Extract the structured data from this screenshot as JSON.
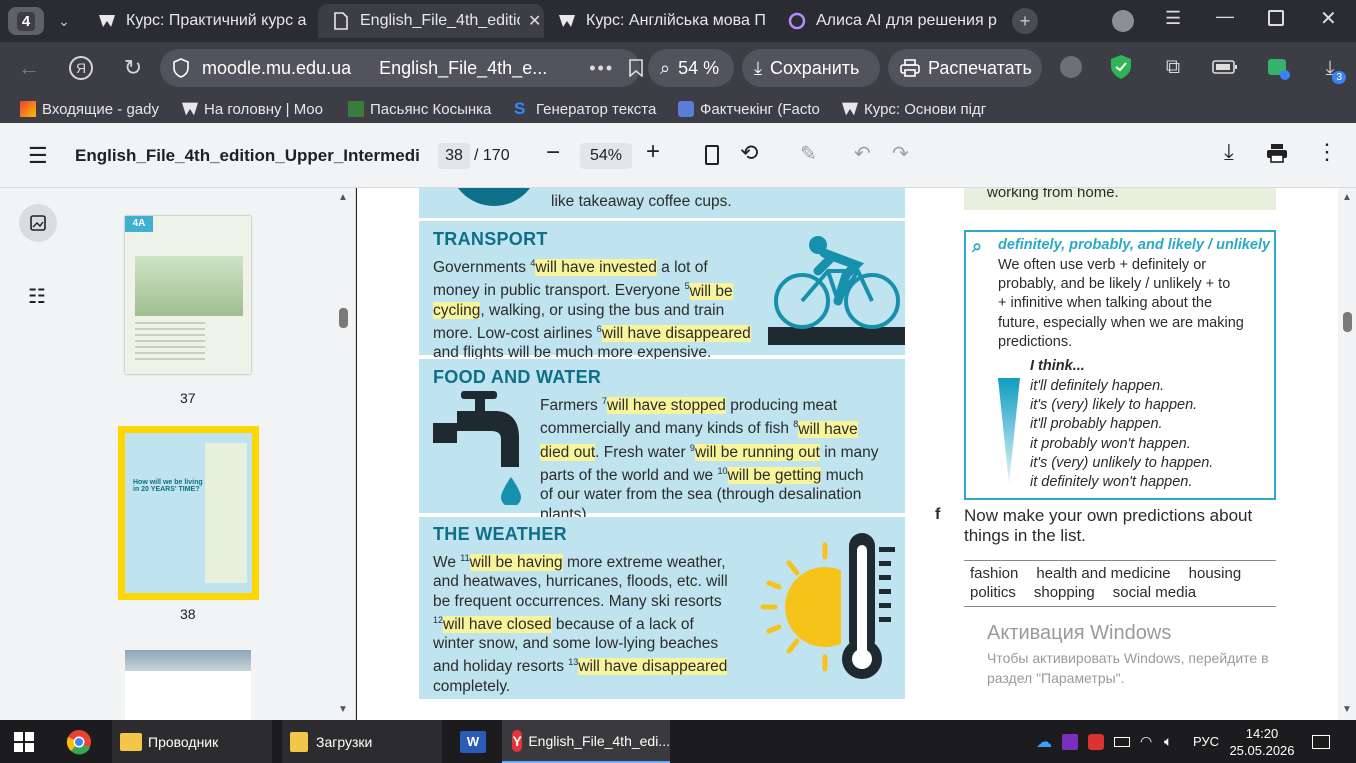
{
  "browser": {
    "tab_count": "4",
    "tabs": [
      {
        "label": "Курс: Практичний курс а"
      },
      {
        "label": "English_File_4th_editio"
      },
      {
        "label": "Курс: Англійська мова П"
      },
      {
        "label": "Алиса AI для решения р"
      }
    ],
    "address": {
      "domain": "moodle.mu.edu.ua",
      "page_title": "English_File_4th_e..."
    },
    "zoom_button": "54 %",
    "save_button": "Сохранить",
    "print_button": "Распечатать",
    "download_badge": "3",
    "bookmarks": [
      "Входящие - gady",
      "На головну | Moo",
      "Пасьянс Косынка",
      "Генератор текста",
      "Фактчекінг (Facto",
      "Курс: Основи підг"
    ],
    "colors": {
      "tabbar": "#2b2c33",
      "toolbar": "#3c3d45",
      "accent": "#2aa9c6",
      "highlight": "#f7f49a"
    }
  },
  "pdf": {
    "title": "English_File_4th_edition_Upper_Intermediat...",
    "page_current": "38",
    "page_total": "/ 170",
    "zoom": "54%",
    "thumbnails": [
      {
        "page": "37",
        "header": "4A"
      },
      {
        "page": "38",
        "header": "How will we be living in 20 YEARS' TIME?"
      }
    ]
  },
  "document": {
    "top_line": "like takeaway coffee cups.",
    "transport": {
      "title": "TRANSPORT",
      "l1a": "Governments ",
      "s4": "4",
      "h4": "will have invested",
      "l1b": " a lot of",
      "l2a": "money in public transport. Everyone ",
      "s5": "5",
      "h5a": "will be",
      "h5b": "cycling",
      "l3b": ", walking, or using the bus and train",
      "l4a": "more. Low-cost airlines ",
      "s6": "6",
      "h6": "will have disappeared",
      "l5": "and flights will be much more expensive."
    },
    "food": {
      "title": "FOOD AND WATER",
      "l1a": "Farmers ",
      "s7": "7",
      "h7": "will have stopped",
      "l1b": " producing meat",
      "l2a": "commercially and many kinds of fish ",
      "s8": "8",
      "h8a": "will have",
      "h8b": "died out",
      "l3a": ". Fresh water ",
      "s9": "9",
      "h9": "will be running out",
      "l3b": " in many",
      "l4a": "parts of the world and we ",
      "s10": "10",
      "h10": "will be getting",
      "l4b": " much",
      "l5": "of our water from the sea (through desalination",
      "l6": "plants)."
    },
    "weather": {
      "title": "THE WEATHER",
      "l1a": "We ",
      "s11": "11",
      "h11": "will be having",
      "l1b": " more extreme weather,",
      "l2": "and heatwaves, hurricanes, floods, etc. will",
      "l3": "be frequent occurrences. Many ski resorts",
      "s12": "12",
      "h12": "will have closed",
      "l4b": " because of a lack of",
      "l5": "winter snow, and some low-lying beaches",
      "l6a": "and holiday resorts ",
      "s13": "13",
      "h13": "will have disappeared",
      "l7": "completely."
    },
    "right_top": "working from home.",
    "note": {
      "title": "definitely, probably, and likely / unlikely",
      "l1": "We often use verb + definitely or",
      "l2": "probably, and be likely / unlikely + to",
      "l3": "+ infinitive when talking about the",
      "l4": "future, especially when we are making",
      "l5": "predictions.",
      "think": "I think...",
      "scale": [
        "it'll definitely happen.",
        "it's (very) likely to happen.",
        "it'll probably happen.",
        "it probably won't happen.",
        "it's (very) unlikely to happen.",
        "it definitely won't happen."
      ]
    },
    "exercise_f": {
      "letter": "f",
      "text1": "Now make your own predictions about",
      "text2": "things in the list."
    },
    "topics_row1": [
      "fashion",
      "health and medicine",
      "housing"
    ],
    "topics_row2": [
      "politics",
      "shopping",
      "social media"
    ],
    "watermark_title": "Активация Windows",
    "watermark_l1": "Чтобы активировать Windows, перейдите в",
    "watermark_l2": "раздел \"Параметры\"."
  },
  "taskbar": {
    "items": [
      "Проводник",
      "Загрузки",
      "English_File_4th_edi..."
    ],
    "lang": "РУС",
    "time": "14:20",
    "date": "25.05.2026"
  }
}
